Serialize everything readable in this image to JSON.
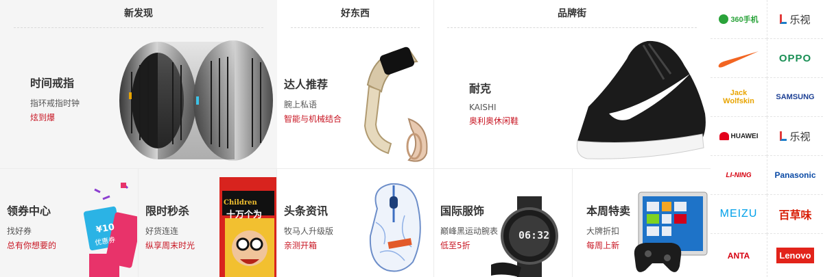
{
  "sections": {
    "new": {
      "title": "新发现",
      "card": {
        "title": "时间戒指",
        "sub": "指环戒指时钟",
        "red": "炫到爆"
      }
    },
    "good": {
      "title": "好东西",
      "card": {
        "title": "达人推荐",
        "sub": "腕上私语",
        "red": "智能与机械结合"
      }
    },
    "brand": {
      "title": "品牌街",
      "card": {
        "title": "耐克",
        "sub": "KAISHI",
        "red": "奥利奥休闲鞋"
      }
    }
  },
  "bottom_cards": [
    {
      "title": "领券中心",
      "sub": "找好券",
      "red": "总有你想要的"
    },
    {
      "title": "限时秒杀",
      "sub": "好货连连",
      "red": "纵享周末时光"
    },
    {
      "title": "头条资讯",
      "sub": "牧马人升级版",
      "red": "亲测开箱"
    },
    {
      "title": "国际服饰",
      "sub": "巅峰黑运动腕表",
      "red": "低至5折"
    },
    {
      "title": "本周特卖",
      "sub": "大牌折扣",
      "red": "每周上新"
    }
  ],
  "coupon": {
    "amount": "¥10",
    "label": "优惠券"
  },
  "book": {
    "title": "十万个为",
    "caption": "Children"
  },
  "watch_face": {
    "time": "06:32"
  },
  "brands": [
    {
      "name": "360手机",
      "color": "#2aa33a"
    },
    {
      "name": "乐视",
      "color": "#333333"
    },
    {
      "name": "",
      "color": "#f26522",
      "icon": "nike-swoosh-icon"
    },
    {
      "name": "OPPO",
      "color": "#1a8f55"
    },
    {
      "name": "Jack Wolfskin",
      "color": "#e8a400"
    },
    {
      "name": "SAMSUNG",
      "color": "#1c3f94"
    },
    {
      "name": "HUAWEI",
      "color": "#222222"
    },
    {
      "name": "乐视",
      "color": "#333333"
    },
    {
      "name": "LI-NING",
      "color": "#d6000f"
    },
    {
      "name": "Panasonic",
      "color": "#0a4aa5"
    },
    {
      "name": "MEIZU",
      "color": "#00a0e9"
    },
    {
      "name": "百草味",
      "color": "#d81e06"
    },
    {
      "name": "ANTA",
      "color": "#d6000f"
    },
    {
      "name": "Lenovo",
      "color": "#e2231a"
    }
  ]
}
